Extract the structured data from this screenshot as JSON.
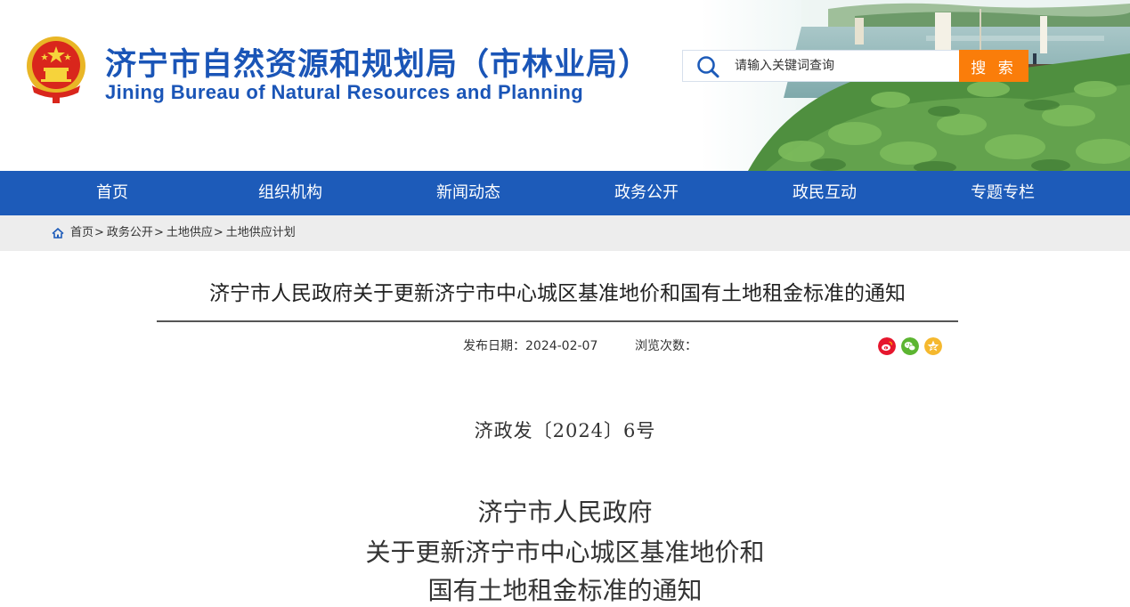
{
  "site": {
    "title_cn": "济宁市自然资源和规划局（市林业局）",
    "title_en": "Jining Bureau of Natural Resources and Planning"
  },
  "search": {
    "placeholder": "请输入关键词查询",
    "button_label": "搜 索"
  },
  "nav": {
    "items": [
      {
        "label": "首页"
      },
      {
        "label": "组织机构"
      },
      {
        "label": "新闻动态"
      },
      {
        "label": "政务公开"
      },
      {
        "label": "政民互动"
      },
      {
        "label": "专题专栏"
      }
    ]
  },
  "breadcrumb": {
    "items": [
      {
        "label": "首页"
      },
      {
        "label": "政务公开"
      },
      {
        "label": "土地供应"
      },
      {
        "label": "土地供应计划"
      }
    ],
    "separator": ">"
  },
  "article": {
    "title": "济宁市人民政府关于更新济宁市中心城区基准地价和国有土地租金标准的通知",
    "publish_date_label": "发布日期：",
    "publish_date": "2024-02-07",
    "views_label": "浏览次数：",
    "doc_number": "济政发〔2024〕6号",
    "heading_lines": [
      "济宁市人民政府",
      "关于更新济宁市中心城区基准地价和",
      "国有土地租金标准的通知"
    ]
  },
  "share": {
    "icons": [
      "weibo-icon",
      "wechat-icon",
      "qq-zone-icon"
    ],
    "colors": {
      "weibo": "#e6162d",
      "wechat": "#5cb531",
      "qzone": "#f5b82e"
    }
  },
  "colors": {
    "brand_blue": "#1d5bb9",
    "search_orange": "#fa7d0a",
    "breadcrumb_bg": "#ededed"
  }
}
